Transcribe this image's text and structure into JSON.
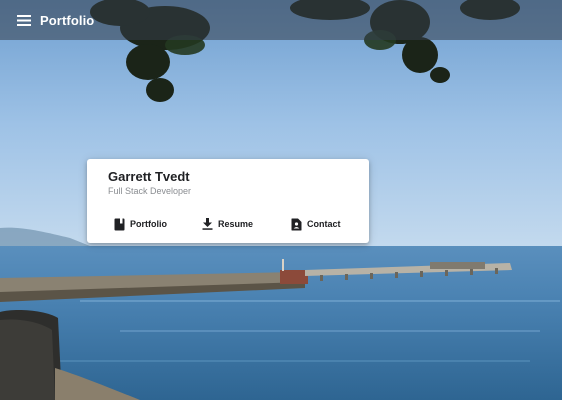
{
  "app": {
    "title": "Portfolio",
    "menu_icon": "menu-icon"
  },
  "profile": {
    "name": "Garrett Tvedt",
    "role": "Full Stack Developer"
  },
  "actions": [
    {
      "label": "Portfolio",
      "icon": "book-icon"
    },
    {
      "label": "Resume",
      "icon": "download-icon"
    },
    {
      "label": "Contact",
      "icon": "contact-card-icon"
    }
  ],
  "colors": {
    "appbar": "#343e4b",
    "card": "#ffffff",
    "sky": "#8fb8de",
    "sea": "#3f78a6"
  }
}
